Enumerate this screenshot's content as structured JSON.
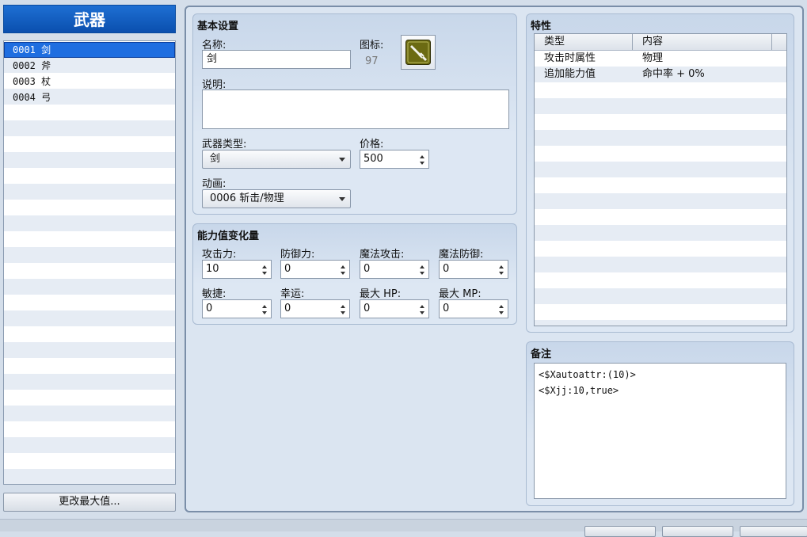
{
  "list": {
    "title": "武器",
    "items": [
      {
        "label": "0001 剑"
      },
      {
        "label": "0002 斧"
      },
      {
        "label": "0003 杖"
      },
      {
        "label": "0004 弓"
      }
    ],
    "max_button": "更改最大值..."
  },
  "basic": {
    "title": "基本设置",
    "name_label": "名称:",
    "name_value": "剑",
    "icon_label": "图标:",
    "icon_index": "97",
    "icon_name": "sword-icon",
    "desc_label": "说明:",
    "desc_value": "",
    "type_label": "武器类型:",
    "type_value": "剑",
    "price_label": "价格:",
    "price_value": "500",
    "anim_label": "动画:",
    "anim_value": "0006 斩击/物理"
  },
  "params": {
    "title": "能力值变化量",
    "fields": [
      {
        "label": "攻击力:",
        "value": "10"
      },
      {
        "label": "防御力:",
        "value": "0"
      },
      {
        "label": "魔法攻击:",
        "value": "0"
      },
      {
        "label": "魔法防御:",
        "value": "0"
      },
      {
        "label": "敏捷:",
        "value": "0"
      },
      {
        "label": "幸运:",
        "value": "0"
      },
      {
        "label": "最大 HP:",
        "value": "0"
      },
      {
        "label": "最大 MP:",
        "value": "0"
      }
    ]
  },
  "traits": {
    "title": "特性",
    "col_type": "类型",
    "col_content": "内容",
    "rows": [
      {
        "type": "攻击时属性",
        "content": "物理"
      },
      {
        "type": "追加能力值",
        "content": "命中率 + 0%"
      }
    ]
  },
  "note": {
    "title": "备注",
    "text": "<$Xautoattr:(10)>\n<$Xjj:10,true>"
  },
  "colors": {
    "header_blue": "#0a4fae",
    "selection_blue": "#1f6ee0",
    "icon_bg": "#6b6a12"
  }
}
